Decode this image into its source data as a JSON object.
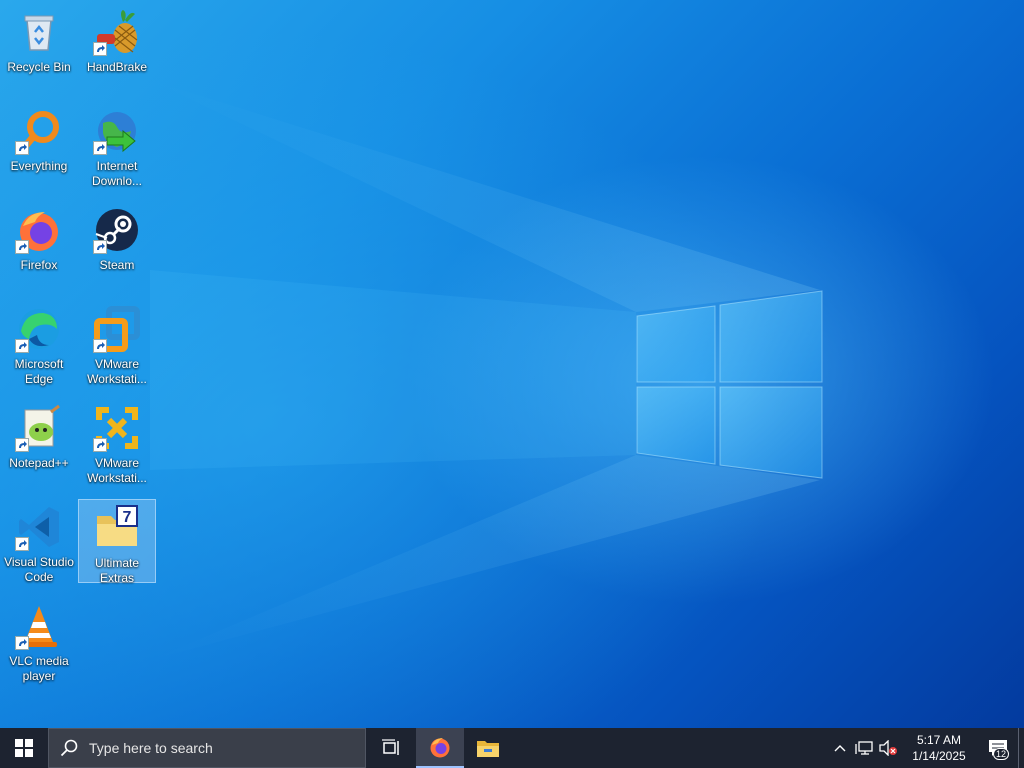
{
  "desktop": {
    "icons": [
      {
        "label": "Recycle Bin",
        "icon": "recycle-bin-icon",
        "shortcut": false
      },
      {
        "label": "HandBrake",
        "icon": "handbrake-icon",
        "shortcut": true
      },
      {
        "label": "Everything",
        "icon": "everything-search-icon",
        "shortcut": true
      },
      {
        "label": "Internet Downlo...",
        "icon": "internet-download-manager-icon",
        "shortcut": true
      },
      {
        "label": "Firefox",
        "icon": "firefox-icon",
        "shortcut": true
      },
      {
        "label": "Steam",
        "icon": "steam-icon",
        "shortcut": true
      },
      {
        "label": "Microsoft Edge",
        "icon": "edge-icon",
        "shortcut": true
      },
      {
        "label": "VMware Workstati...",
        "icon": "vmware-workstation-icon",
        "shortcut": true
      },
      {
        "label": "Notepad++",
        "icon": "notepad-plus-plus-icon",
        "shortcut": true
      },
      {
        "label": "VMware Workstati...",
        "icon": "vmware-workstation-player-icon",
        "shortcut": true
      },
      {
        "label": "Visual Studio Code",
        "icon": "vscode-icon",
        "shortcut": true
      },
      {
        "label": "Ultimate Extras",
        "icon": "folder-icon",
        "shortcut": false,
        "selected": true
      },
      {
        "label": "VLC media player",
        "icon": "vlc-icon",
        "shortcut": true
      }
    ]
  },
  "taskbar": {
    "search_placeholder": "Type here to search",
    "pinned": [
      "task-view-icon",
      "firefox-icon",
      "file-explorer-icon"
    ],
    "tray": {
      "time": "5:17 AM",
      "date": "1/14/2025",
      "notification_count": "12"
    }
  },
  "colors": {
    "taskbar_bg": "#1d2330",
    "wallpaper_accent": "#0a6fd6"
  }
}
